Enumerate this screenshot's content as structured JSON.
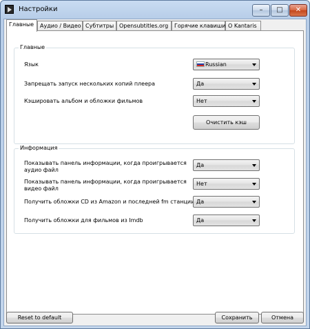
{
  "window": {
    "title": "Настройки",
    "icons": {
      "app": "player-icon",
      "minimize": "minimize-icon",
      "maximize": "maximize-icon",
      "close": "close-icon"
    }
  },
  "tabs": [
    {
      "label": "Главные",
      "active": true
    },
    {
      "label": "Аудио / Видео"
    },
    {
      "label": "Субтитры"
    },
    {
      "label": "Opensubtitles.org"
    },
    {
      "label": "Горячие клавиши"
    },
    {
      "label": "О Kantaris"
    }
  ],
  "general": {
    "legend": "Главные",
    "language_label": "Язык",
    "language_value": "Russian",
    "multi_instance_label": "Запрещать запуск нескольких копий плеера",
    "multi_instance_value": "Да",
    "cache_label": "Кэшировать альбом и обложки фильмов",
    "cache_value": "Нет",
    "clear_cache": "Очистить кэш"
  },
  "info": {
    "legend": "Информация",
    "audio_panel_label": "Показывать панель информации, когда проигрывается аудио файл",
    "audio_panel_value": "Да",
    "video_panel_label": "Показывать панель информации, когда проигрывается видео файл",
    "video_panel_value": "Нет",
    "cd_covers_label": "Получить обложки CD из Amazon и последней fm станции",
    "cd_covers_value": "Да",
    "imdb_label": "Получить обложки для фильмов из Imdb",
    "imdb_value": "Да"
  },
  "footer": {
    "reset": "Reset to default",
    "save": "Сохранить",
    "cancel": "Отмена"
  }
}
